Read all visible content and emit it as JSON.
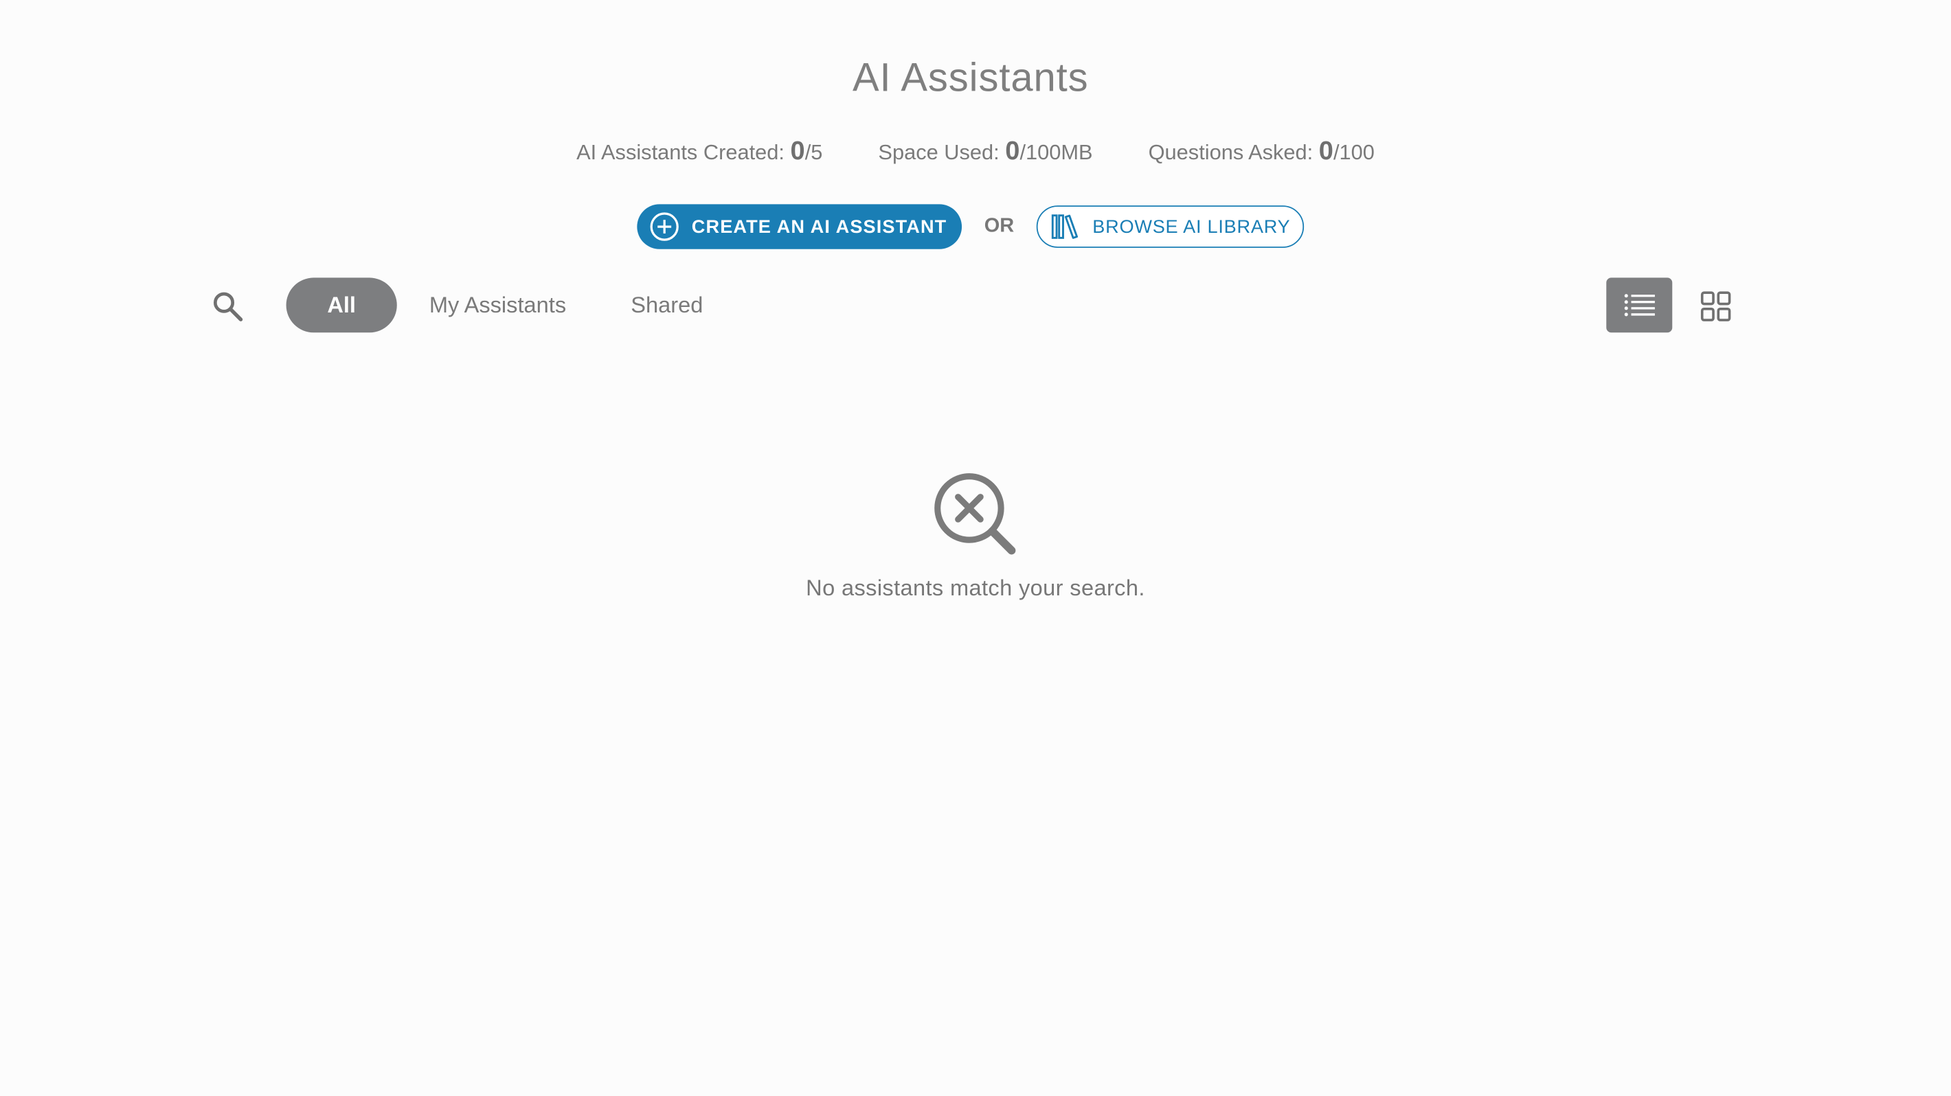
{
  "header": {
    "title": "AI Assistants"
  },
  "stats": {
    "created_label": "AI Assistants Created: ",
    "created_value": "0",
    "created_total": "/5",
    "space_label": "Space Used: ",
    "space_value": "0",
    "space_total": "/100MB",
    "questions_label": "Questions Asked: ",
    "questions_value": "0",
    "questions_total": "/100"
  },
  "actions": {
    "create_label": "CREATE AN AI ASSISTANT",
    "or_label": "OR",
    "browse_label": "BROWSE AI LIBRARY"
  },
  "filters": {
    "tabs": [
      {
        "label": "All",
        "active": true
      },
      {
        "label": "My Assistants",
        "active": false
      },
      {
        "label": "Shared",
        "active": false
      }
    ],
    "view_mode": "list"
  },
  "empty_state": {
    "icon": "search-x-icon",
    "message": "No assistants match your search."
  },
  "colors": {
    "accent": "#1a7eb5",
    "active_tab_bg": "#7d7e80",
    "text_muted": "#777777",
    "background": "#fcfcfc"
  }
}
